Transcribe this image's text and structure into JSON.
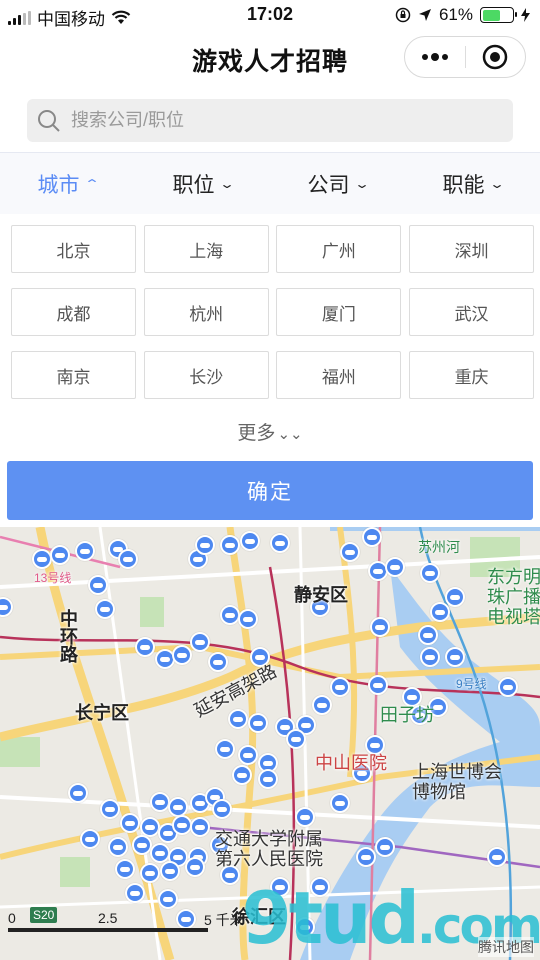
{
  "status_bar": {
    "carrier": "中国移动",
    "time": "17:02",
    "battery": "61%",
    "battery_level": 0.61
  },
  "nav": {
    "title": "游戏人才招聘",
    "menu_icon": "more-dots-icon",
    "close_icon": "target-circle-icon"
  },
  "search": {
    "placeholder": "搜索公司/职位",
    "value": ""
  },
  "filters": [
    {
      "label": "城市",
      "active": true
    },
    {
      "label": "职位",
      "active": false
    },
    {
      "label": "公司",
      "active": false
    },
    {
      "label": "职能",
      "active": false
    }
  ],
  "cities": [
    "北京",
    "上海",
    "广州",
    "深圳",
    "成都",
    "杭州",
    "厦门",
    "武汉",
    "南京",
    "长沙",
    "福州",
    "重庆"
  ],
  "more_label": "更多",
  "confirm_label": "确定",
  "map": {
    "labels": {
      "jingan": "静安区",
      "changning": "长宁区",
      "zhonghuan": "中环路",
      "yanan": "延安高架路",
      "zhongshan": "中山医院",
      "expo": "上海世博会博物馆",
      "jiaotong": "交通大学附属第六人民医院",
      "xuhui": "徐汇区",
      "dongfang": "东方明珠广播电视塔",
      "line13": "13号线",
      "line9": "9号线",
      "tian": "田子坊",
      "suzhou": "苏州河"
    },
    "scale": {
      "zero": "0",
      "mid": "2.5",
      "end": "5 千米",
      "road": "S20"
    },
    "attribution": "腾讯地图",
    "watermark": "9tud.com",
    "colors": {
      "marker": "#4d88f0",
      "accent": "#5e91f2"
    }
  }
}
